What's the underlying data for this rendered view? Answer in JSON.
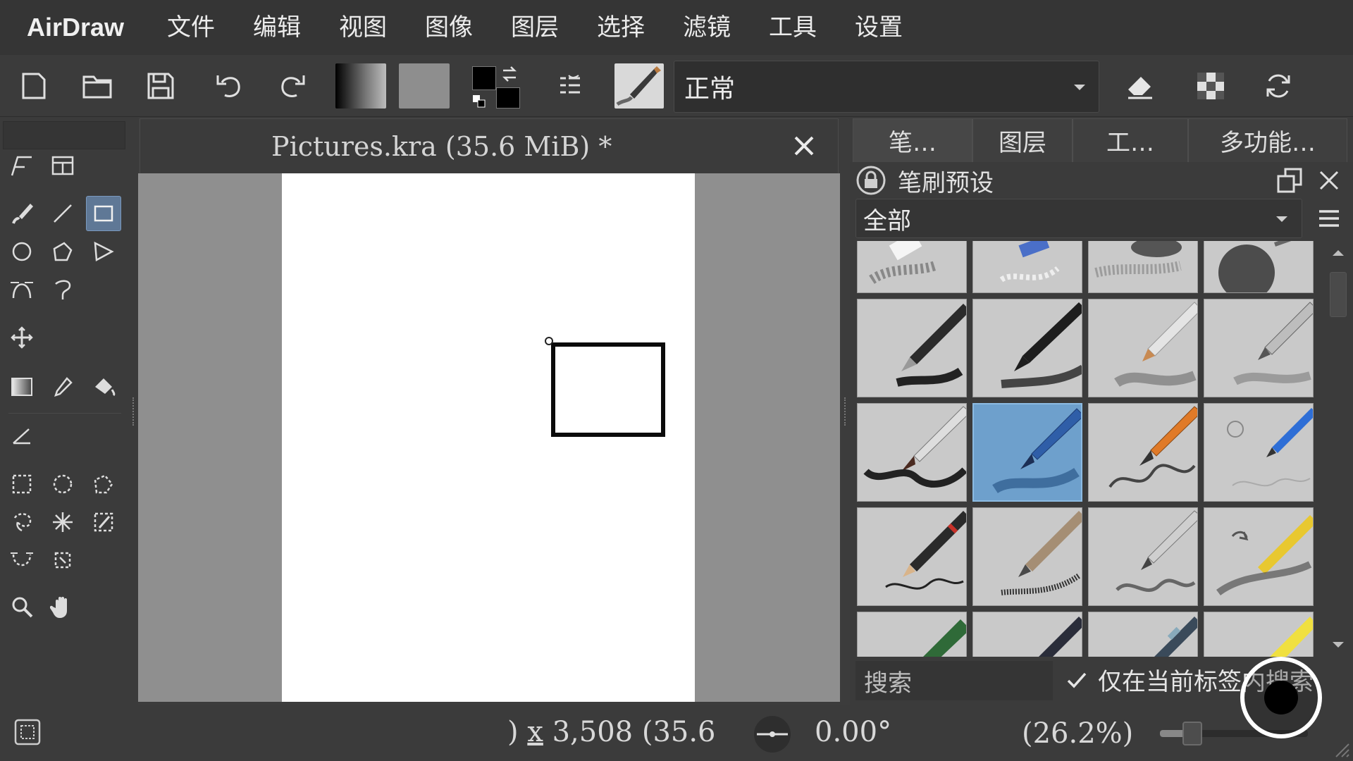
{
  "app": {
    "title": "AirDraw"
  },
  "menu": [
    "文件",
    "编辑",
    "视图",
    "图像",
    "图层",
    "选择",
    "滤镜",
    "工具",
    "设置"
  ],
  "toolbar": {
    "blend_mode": "正常",
    "foreground_color": "#000000",
    "background_color": "#000000"
  },
  "document": {
    "tab_title": "Pictures.kra (35.6 MiB) *",
    "canvas_color": "#ffffff"
  },
  "dock": {
    "tabs": [
      "笔…",
      "图层",
      "工…",
      "多功能…"
    ],
    "active_tab": "笔…",
    "panel_title": "笔刷预设",
    "tag_filter": "全部",
    "search_placeholder": "搜索",
    "search_in_tag_label": "仅在当前标签内搜索",
    "search_in_tag_checked": true,
    "selected_brush_index": 5
  },
  "status": {
    "dimensions_prefix": ")",
    "dimensions_x": "x",
    "dimensions_text": "3,508 (35.6",
    "rotation": "0.00°",
    "zoom": "(26.2%)",
    "zoom_level": 0.22
  },
  "colors": {
    "accent": "#5f7896",
    "selected_brush": "#6ea0cc"
  }
}
